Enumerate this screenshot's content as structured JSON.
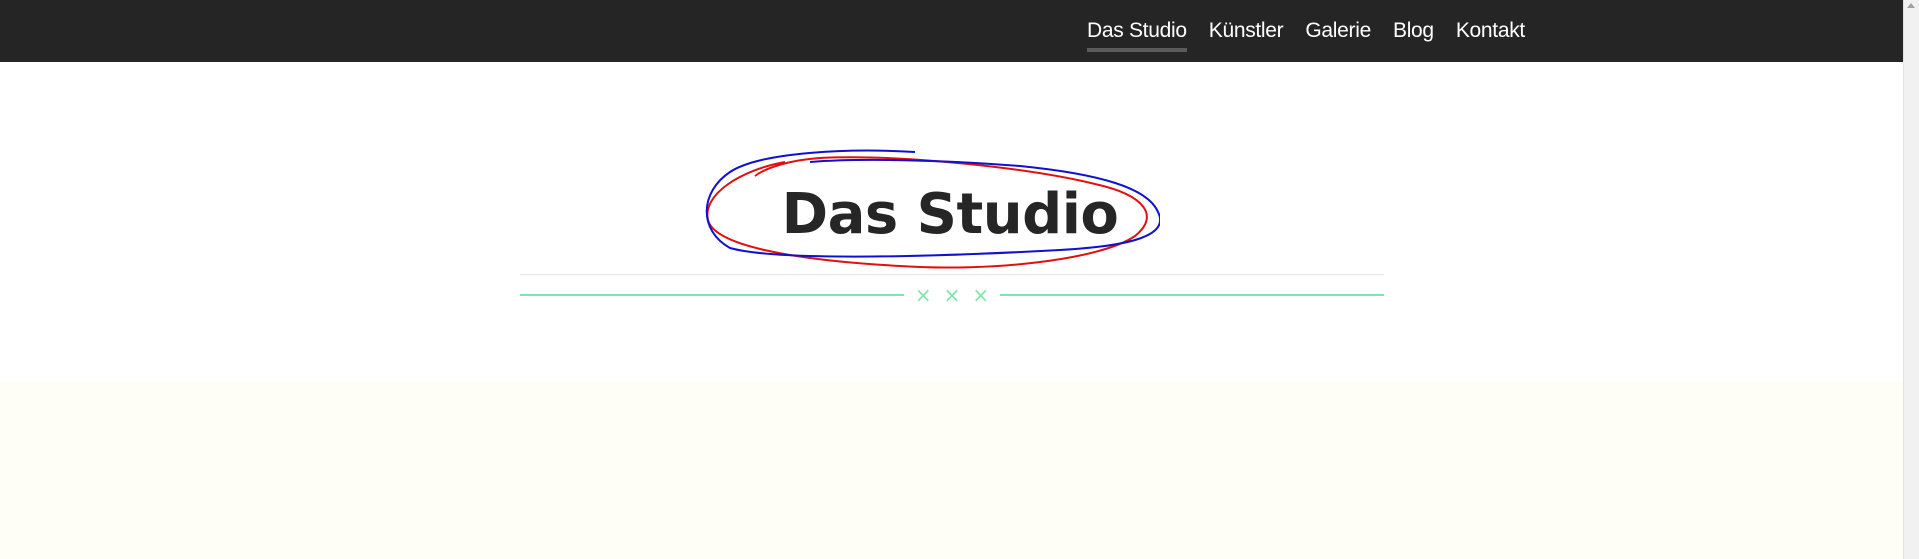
{
  "nav": {
    "items": [
      {
        "label": "Das Studio",
        "active": true
      },
      {
        "label": "Künstler",
        "active": false
      },
      {
        "label": "Galerie",
        "active": false
      },
      {
        "label": "Blog",
        "active": false
      },
      {
        "label": "Kontakt",
        "active": false
      }
    ]
  },
  "hero": {
    "title": "Das Studio",
    "divider_marks": [
      "×",
      "×",
      "×"
    ]
  },
  "colors": {
    "navbar_bg": "#252525",
    "nav_text": "#ffffff",
    "nav_active_underline": "#5b5b5b",
    "title_text": "#262626",
    "accent_green": "#7fe3aa",
    "cream_section_bg": "#fffef6",
    "annotation_red": "#e01010",
    "annotation_blue": "#1010d0"
  },
  "icons": {
    "divider_mark": "cross-mark-icon",
    "scroll_up": "scroll-up-arrow-icon"
  }
}
